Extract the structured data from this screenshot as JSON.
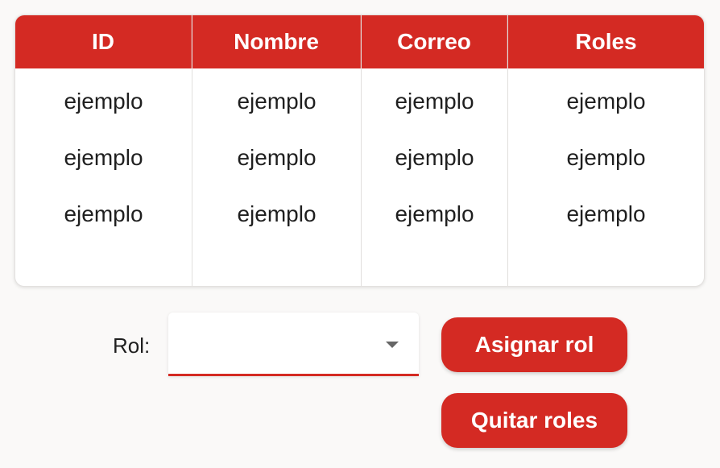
{
  "table": {
    "headers": [
      "ID",
      "Nombre",
      "Correo",
      "Roles"
    ],
    "rows": [
      [
        "ejemplo",
        "ejemplo",
        "ejemplo",
        "ejemplo"
      ],
      [
        "ejemplo",
        "ejemplo",
        "ejemplo",
        "ejemplo"
      ],
      [
        "ejemplo",
        "ejemplo",
        "ejemplo",
        "ejemplo"
      ]
    ]
  },
  "form": {
    "role_label": "Rol:",
    "role_select": {
      "value": ""
    },
    "assign_button": "Asignar rol",
    "remove_button": "Quitar roles"
  },
  "colors": {
    "accent": "#d42a23",
    "background": "#faf9f8"
  },
  "icons": {
    "dropdown": "chevron-down-icon"
  }
}
